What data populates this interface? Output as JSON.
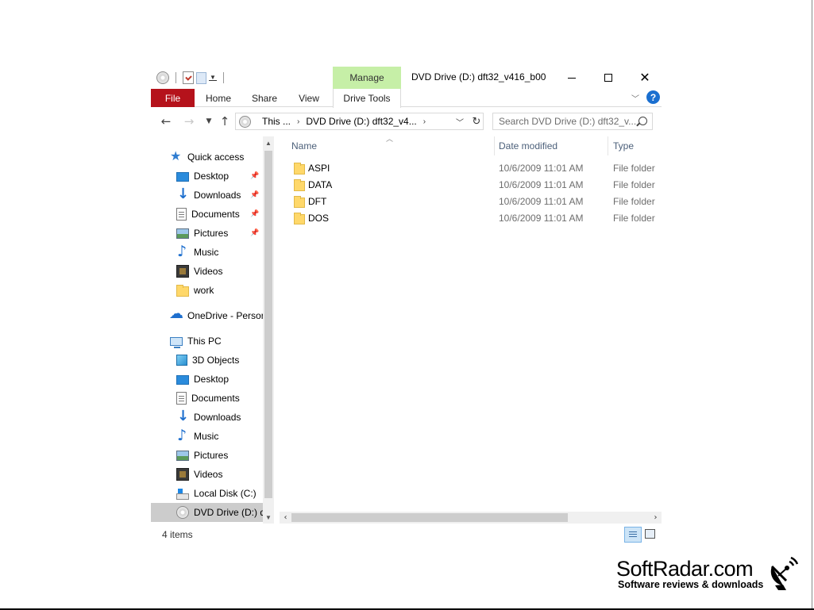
{
  "titlebar": {
    "window_title": "DVD Drive (D:) dft32_v416_b00",
    "manage_label": "Manage",
    "close_glyph": "✕"
  },
  "ribbon": {
    "tabs": [
      "File",
      "Home",
      "Share",
      "View",
      "Drive Tools"
    ],
    "help_label": "?"
  },
  "navbar": {
    "address_segments": [
      "This ...",
      "DVD Drive (D:) dft32_v4..."
    ],
    "search_placeholder": "Search DVD Drive (D:) dft32_v..."
  },
  "navpane": {
    "items": [
      {
        "label": "Quick access",
        "icon": "star-icon",
        "pinned": false
      },
      {
        "label": "Desktop",
        "icon": "desktop-icon",
        "pinned": true
      },
      {
        "label": "Downloads",
        "icon": "download-icon",
        "pinned": true
      },
      {
        "label": "Documents",
        "icon": "document-icon",
        "pinned": true
      },
      {
        "label": "Pictures",
        "icon": "picture-icon",
        "pinned": true
      },
      {
        "label": "Music",
        "icon": "music-icon",
        "pinned": false
      },
      {
        "label": "Videos",
        "icon": "video-icon",
        "pinned": false
      },
      {
        "label": "work",
        "icon": "folder-icon",
        "pinned": false
      },
      {
        "label": "OneDrive - Persor",
        "icon": "cloud-icon",
        "pinned": false
      },
      {
        "label": "This PC",
        "icon": "computer-icon",
        "pinned": false
      },
      {
        "label": "3D Objects",
        "icon": "cube-icon",
        "pinned": false
      },
      {
        "label": "Desktop",
        "icon": "desktop-icon",
        "pinned": false
      },
      {
        "label": "Documents",
        "icon": "document-icon",
        "pinned": false
      },
      {
        "label": "Downloads",
        "icon": "download-icon",
        "pinned": false
      },
      {
        "label": "Music",
        "icon": "music-icon",
        "pinned": false
      },
      {
        "label": "Pictures",
        "icon": "picture-icon",
        "pinned": false
      },
      {
        "label": "Videos",
        "icon": "video-icon",
        "pinned": false
      },
      {
        "label": "Local Disk (C:)",
        "icon": "hard-disk-icon",
        "pinned": false
      },
      {
        "label": "DVD Drive (D:) df",
        "icon": "dvd-icon",
        "pinned": false,
        "selected": true
      }
    ]
  },
  "filelist": {
    "columns": [
      "Name",
      "Date modified",
      "Type"
    ],
    "rows": [
      {
        "name": "ASPI",
        "date": "10/6/2009 11:01 AM",
        "type": "File folder"
      },
      {
        "name": "DATA",
        "date": "10/6/2009 11:01 AM",
        "type": "File folder"
      },
      {
        "name": "DFT",
        "date": "10/6/2009 11:01 AM",
        "type": "File folder"
      },
      {
        "name": "DOS",
        "date": "10/6/2009 11:01 AM",
        "type": "File folder"
      }
    ]
  },
  "statusbar": {
    "item_count": "4 items"
  },
  "watermark": {
    "title": "SoftRadar.com",
    "tagline": "Software reviews & downloads"
  },
  "colors": {
    "file_tab": "#b5121b",
    "manage_tab": "#c6efa7",
    "accent": "#1a6fd0",
    "selected_nav": "#cccccc"
  }
}
